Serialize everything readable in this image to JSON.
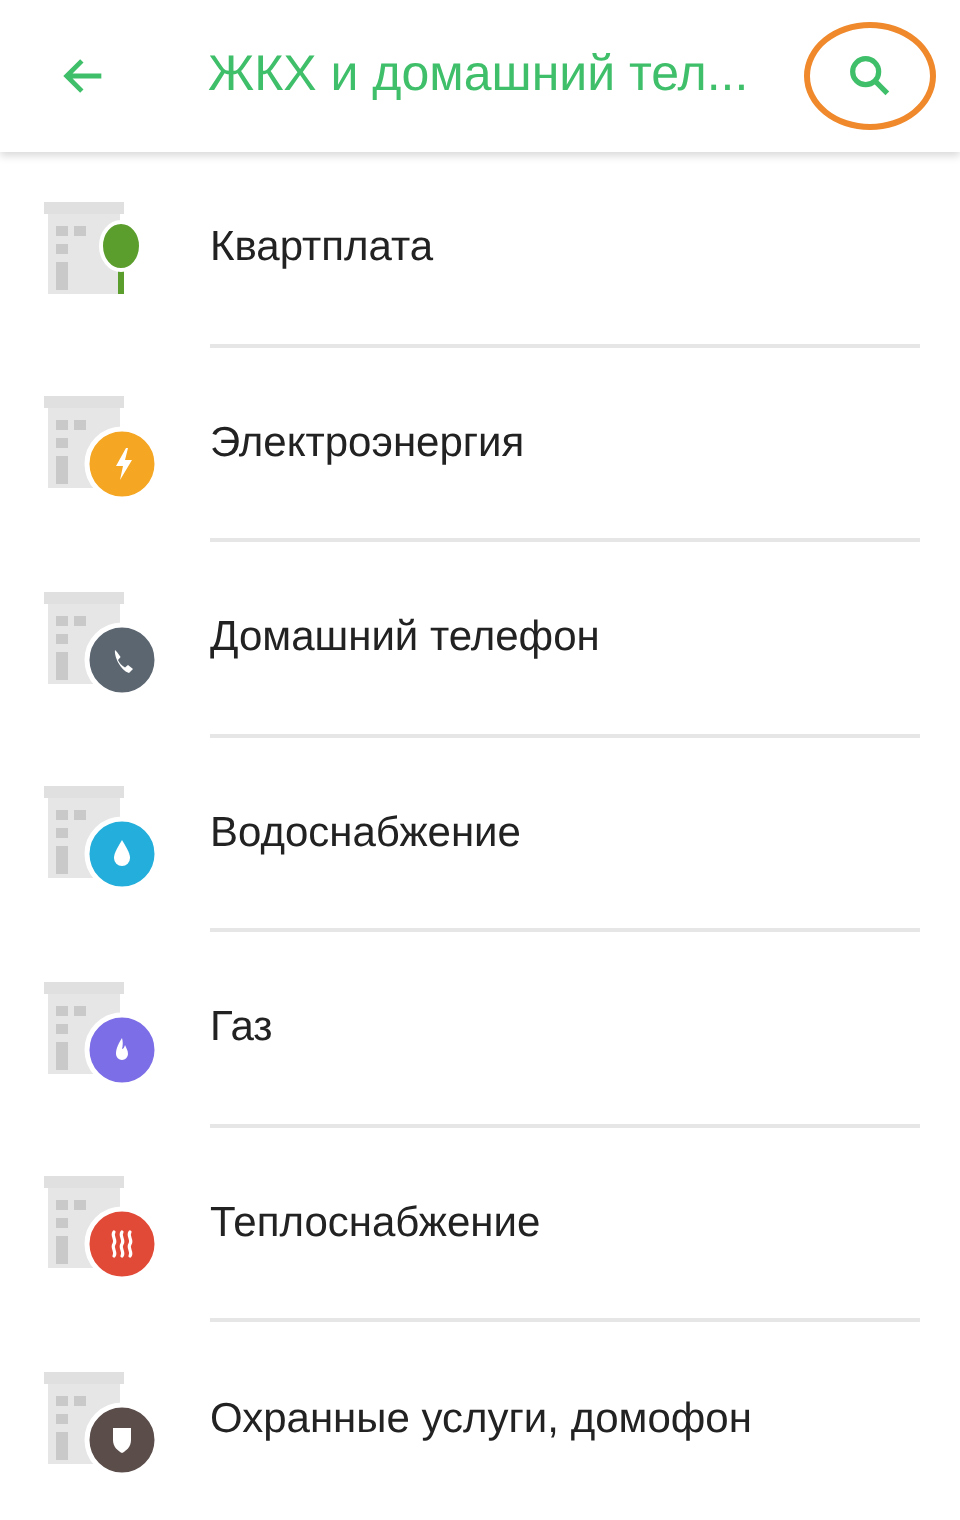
{
  "header": {
    "title": "ЖКХ и домашний тел..."
  },
  "items": [
    {
      "label": "Квартплата",
      "kind": "tree",
      "color": "#5c9e2e"
    },
    {
      "label": "Электроэнергия",
      "kind": "bolt",
      "color": "#f5a623"
    },
    {
      "label": "Домашний телефон",
      "kind": "phone",
      "color": "#5c6671"
    },
    {
      "label": "Водоснабжение",
      "kind": "drop",
      "color": "#23aedb"
    },
    {
      "label": "Газ",
      "kind": "flame",
      "color": "#7c6ee6"
    },
    {
      "label": "Теплоснабжение",
      "kind": "heat",
      "color": "#e24a38"
    },
    {
      "label": "Охранные услуги, домофон",
      "kind": "shield",
      "color": "#5a4d4a"
    }
  ]
}
